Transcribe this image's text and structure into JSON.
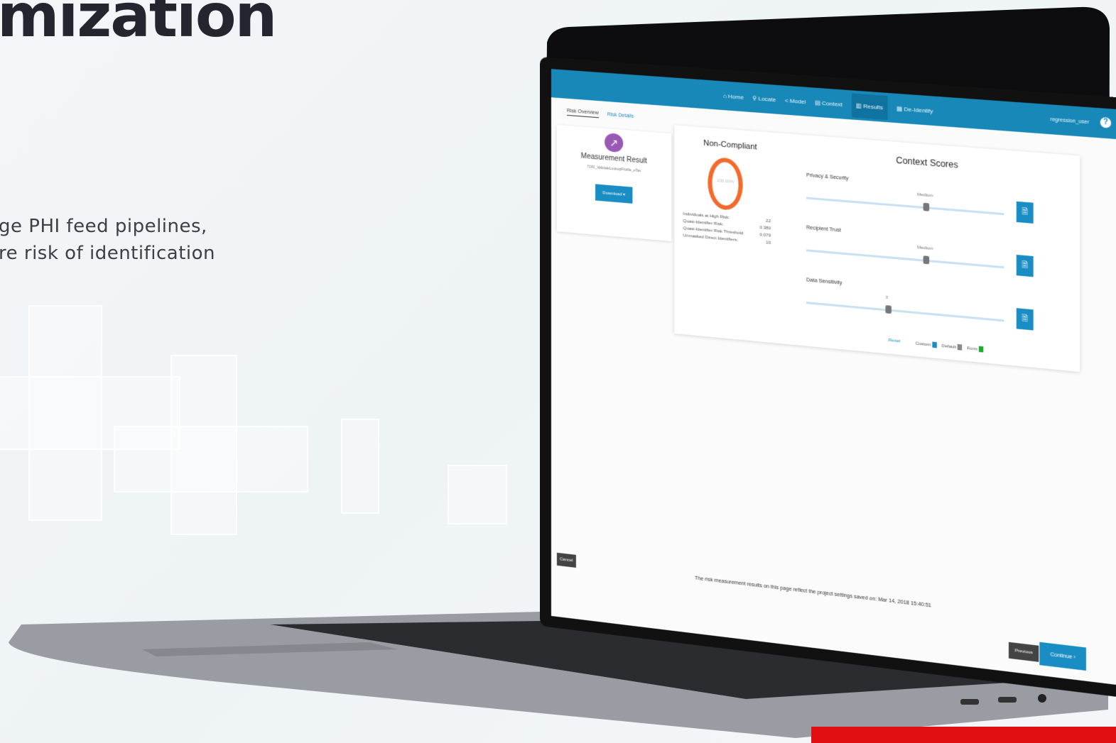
{
  "hero": {
    "title": "mization",
    "description": "ge PHI feed pipelines,\nre risk of identification"
  },
  "app": {
    "nav": [
      {
        "icon": "home-icon",
        "label": "Home"
      },
      {
        "icon": "pin-icon",
        "label": "Locate"
      },
      {
        "icon": "share-icon",
        "label": "Model"
      },
      {
        "icon": "table-icon",
        "label": "Context"
      },
      {
        "icon": "chart-icon",
        "label": "Results"
      },
      {
        "icon": "grid-icon",
        "label": "De-Identify"
      }
    ],
    "user": "regression_user",
    "help": "?",
    "subtabs": {
      "overview": "Risk Overview",
      "details": "Risk Details"
    },
    "measurement": {
      "title": "Measurement Result",
      "file": "7140_ValidateLookupProfile_eTax",
      "download": "Download ▾"
    },
    "compliance": {
      "status": "Non-Compliant",
      "percent": "100.00%",
      "stats": [
        {
          "label": "Individuals at High Risk:",
          "value": "22"
        },
        {
          "label": "Quasi-Identifier Risk:",
          "value": "0.380"
        },
        {
          "label": "Quasi-Identifier Risk Threshold:",
          "value": "0.079"
        },
        {
          "label": "Unmasked Direct Identifiers:",
          "value": "10"
        }
      ]
    },
    "context_scores": {
      "title": "Context Scores",
      "sliders": [
        {
          "label": "Privacy & Security",
          "value": "Medium",
          "level": 0.6
        },
        {
          "label": "Recipient Trust",
          "value": "Medium",
          "level": 0.6
        },
        {
          "label": "Data Sensitivity",
          "value": "3",
          "level": 0.42
        }
      ],
      "reset": "Reset",
      "legend": [
        {
          "label": "Custom",
          "color": "#1a8ec4"
        },
        {
          "label": "Default",
          "color": "#888888"
        },
        {
          "label": "Form",
          "color": "#22aa33"
        }
      ]
    },
    "footer_note": "The risk measurement results on this page reflect the project settings saved on: Mar 14, 2018 15:40:51",
    "cancel": "Cancel",
    "previous": "Previous",
    "continue": "Continue ›"
  },
  "colors": {
    "accent": "#1888b8",
    "danger": "#e01010",
    "ring": "#f26b2e"
  }
}
